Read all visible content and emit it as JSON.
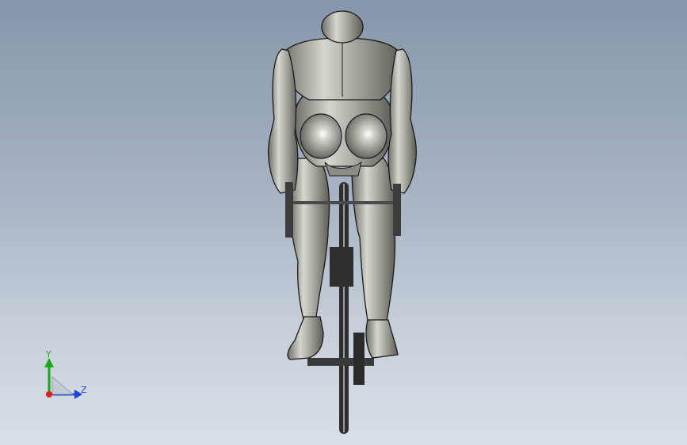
{
  "viewport": {
    "background_top": "#8796ab",
    "background_bottom": "#d9dfe6"
  },
  "model": {
    "subject": "cyclist-on-road-bicycle-rear-view",
    "material_color": "#b9b9b1",
    "edge_color": "#1a1a1a"
  },
  "triad": {
    "y_label": "Y",
    "z_label": "Z",
    "y_color": "#17a817",
    "z_color": "#1b44d8",
    "x_color": "#d81b1b"
  }
}
